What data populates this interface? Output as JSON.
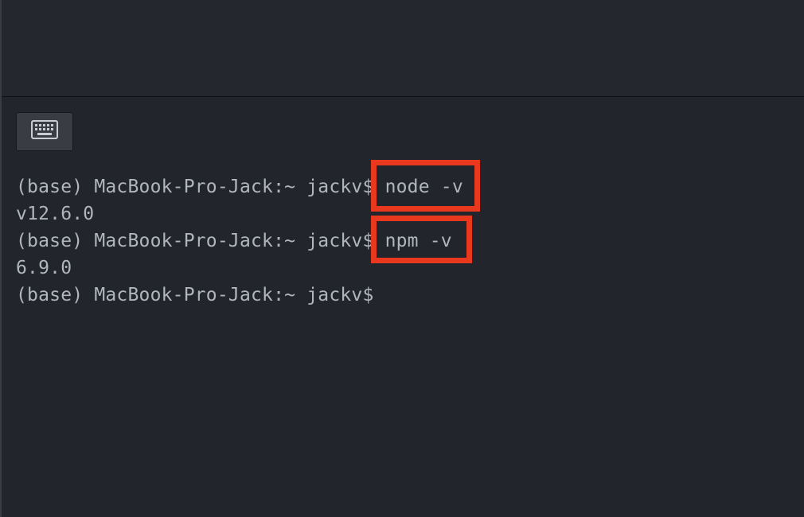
{
  "terminal": {
    "lines": [
      {
        "prompt": "(base) MacBook-Pro-Jack:~ jackv$ ",
        "command": "node -v"
      },
      {
        "output": "v12.6.0"
      },
      {
        "prompt": "(base) MacBook-Pro-Jack:~ jackv$ ",
        "command": "npm -v"
      },
      {
        "output": "6.9.0"
      },
      {
        "prompt": "(base) MacBook-Pro-Jack:~ jackv$"
      }
    ]
  },
  "toolbar": {
    "keyboard_icon": "keyboard-icon"
  },
  "colors": {
    "background": "#23252c",
    "text": "#b1b5be",
    "highlight": "#e8391f"
  }
}
